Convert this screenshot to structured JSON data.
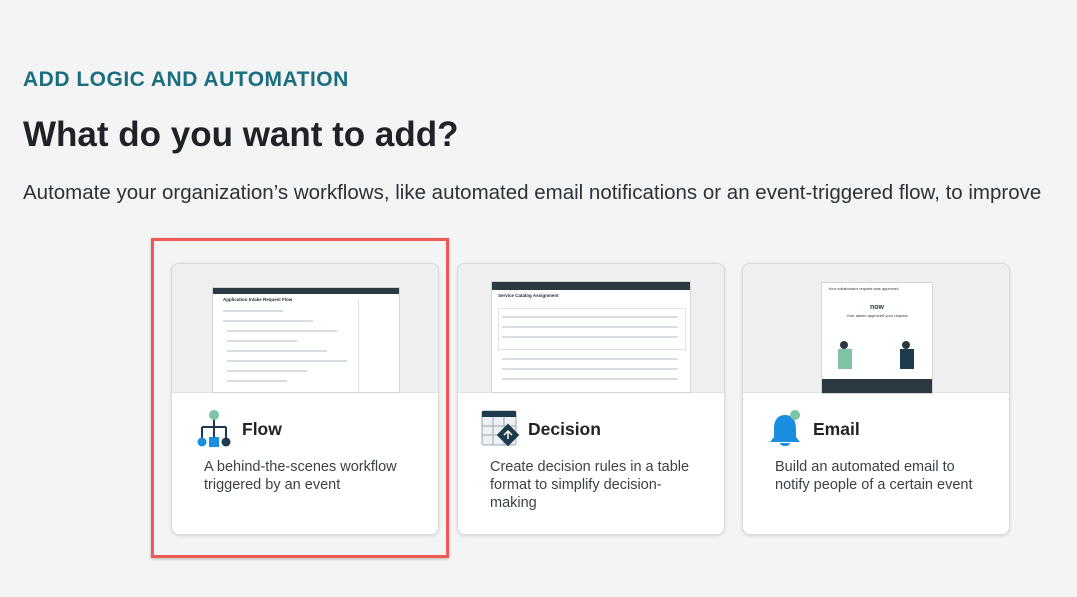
{
  "header": {
    "eyebrow": "ADD LOGIC AND AUTOMATION",
    "title": "What do you want to add?",
    "description": "Automate your organization’s workflows, like automated email notifications or an event-triggered flow, to improve"
  },
  "cards": [
    {
      "title": "Flow",
      "description": "A behind-the-scenes workflow triggered by an event",
      "icon": "flow-icon",
      "selected": true
    },
    {
      "title": "Decision",
      "description": "Create decision rules in a table format to simplify decision-making",
      "icon": "decision-table-icon",
      "selected": false
    },
    {
      "title": "Email",
      "description": "Build an automated email to notify people of a certain event",
      "icon": "bell-icon",
      "selected": false
    }
  ],
  "previews": {
    "flow": {
      "window_title": "Application Intake Request Flow"
    },
    "decision": {
      "window_title": "Service Catalog Assignment"
    },
    "email": {
      "heading": "Your collaborator request was approved",
      "brand": "now",
      "message": "Your admin approved your request"
    }
  },
  "colors": {
    "accent": "#1a6e7e",
    "highlight": "#ee5a52",
    "icon_teal": "#7fc4a4",
    "icon_blue": "#1a8fe0",
    "icon_navy": "#1e3b4e"
  }
}
